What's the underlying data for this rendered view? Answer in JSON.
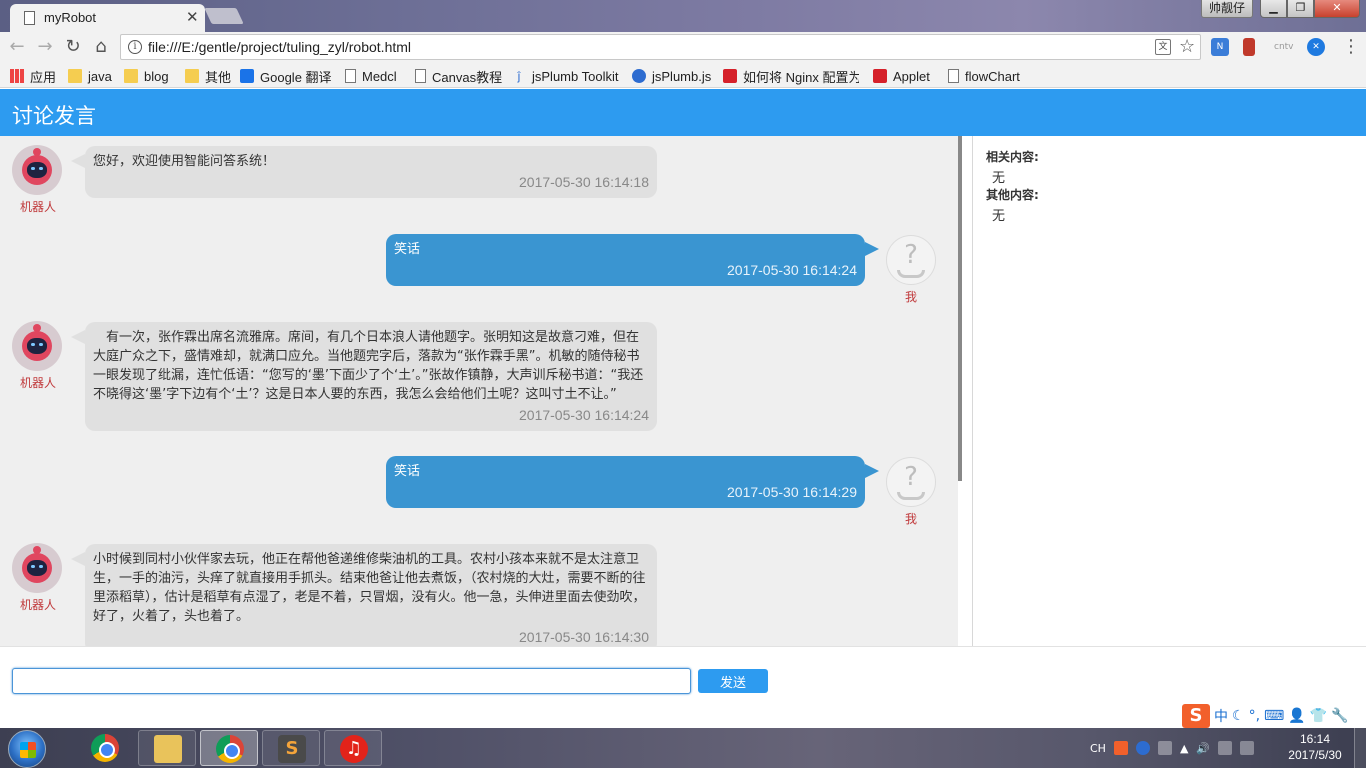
{
  "browser": {
    "tab_title": "myRobot",
    "url": "file:///E:/gentle/project/tuling_zyl/robot.html",
    "user_badge": "帅靓仔",
    "bookmarks": [
      {
        "label": "应用",
        "icon": "apps-grid-icon"
      },
      {
        "label": "java",
        "icon": "folder-icon"
      },
      {
        "label": "blog",
        "icon": "folder-icon"
      },
      {
        "label": "其他",
        "icon": "folder-icon"
      },
      {
        "label": "Google 翻译",
        "icon": "translate-icon"
      },
      {
        "label": "Medcl",
        "icon": "page-icon"
      },
      {
        "label": "Canvas教程",
        "icon": "page-icon"
      },
      {
        "label": "jsPlumb Toolkit",
        "icon": "jsplumb-icon"
      },
      {
        "label": "jsPlumb.js",
        "icon": "globe-icon"
      },
      {
        "label": "如何将 Nginx 配置为",
        "icon": "csdn-icon"
      },
      {
        "label": "Applet",
        "icon": "csdn-icon"
      },
      {
        "label": "flowChart",
        "icon": "page-icon"
      }
    ]
  },
  "app": {
    "title": "讨论发言",
    "robot_name": "机器人",
    "user_name": "我",
    "messages": [
      {
        "from": "robot",
        "text": "您好，欢迎使用智能问答系统！",
        "time": "2017-05-30 16:14:18"
      },
      {
        "from": "user",
        "text": "笑话",
        "time": "2017-05-30 16:14:24"
      },
      {
        "from": "robot",
        "text": "　有一次，张作霖出席名流雅席。席间，有几个日本浪人请他题字。张明知这是故意刁难，但在大庭广众之下，盛情难却，就满口应允。当他题完字后，落款为“张作霖手黑”。机敏的随侍秘书一眼发现了纰漏，连忙低语：“您写的‘墨’下面少了个‘土’。”张故作镇静，大声训斥秘书道：“我还不晓得这‘墨’字下边有个‘土’？这是日本人要的东西，我怎么会给他们土呢？这叫寸土不让。”",
        "time": "2017-05-30 16:14:24"
      },
      {
        "from": "user",
        "text": "笑话",
        "time": "2017-05-30 16:14:29"
      },
      {
        "from": "robot",
        "text": "小时候到同村小伙伴家去玩，他正在帮他爸递维修柴油机的工具。农村小孩本来就不是太注意卫生，一手的油污，头痒了就直接用手抓头。结束他爸让他去煮饭，（农村烧的大灶，需要不断的往里添稻草），估计是稻草有点湿了，老是不着，只冒烟，没有火。他一急，头伸进里面去使劲吹，好了，火着了，头也着了。",
        "time": "2017-05-30 16:14:30"
      }
    ],
    "side": {
      "related_label": "相关内容:",
      "related_value": "无",
      "other_label": "其他内容:",
      "other_value": "无"
    },
    "input_value": "",
    "send_label": "发送"
  },
  "ime": {
    "mode": "中"
  },
  "taskbar": {
    "lang": "CH",
    "time": "16:14",
    "date": "2017/5/30"
  },
  "colors": {
    "header": "#2d9bf0",
    "user_bubble": "#3a95d1",
    "robot_bubble": "#e0e0e0",
    "name": "#c0393b"
  }
}
